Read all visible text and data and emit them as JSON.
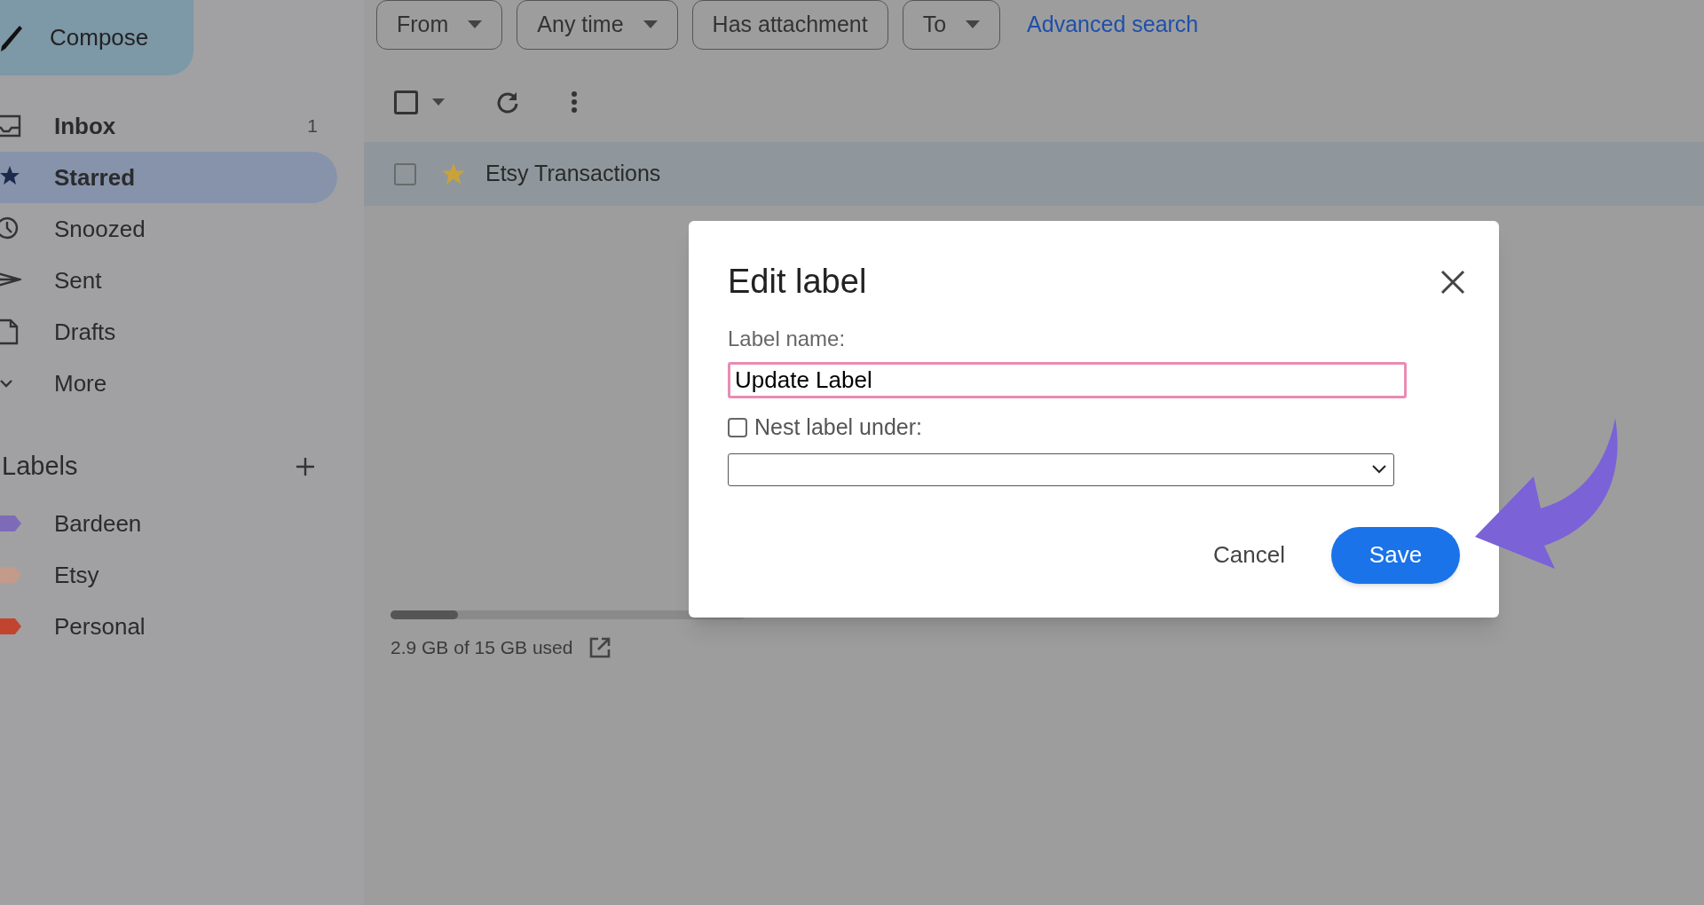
{
  "compose": {
    "label": "Compose"
  },
  "nav": [
    {
      "label": "Inbox",
      "count": "1",
      "unread": true,
      "selected": false
    },
    {
      "label": "Starred",
      "unread": false,
      "selected": true
    },
    {
      "label": "Snoozed",
      "unread": false,
      "selected": false
    },
    {
      "label": "Sent",
      "unread": false,
      "selected": false
    },
    {
      "label": "Drafts",
      "unread": false,
      "selected": false
    },
    {
      "label": "More",
      "unread": false,
      "selected": false
    }
  ],
  "labels_heading": "Labels",
  "labels": [
    {
      "label": "Bardeen",
      "color": "#7e6bb8"
    },
    {
      "label": "Etsy",
      "color": "#c49a8a"
    },
    {
      "label": "Personal",
      "color": "#c2442f"
    }
  ],
  "filters": [
    {
      "label": "From",
      "dropdown": true
    },
    {
      "label": "Any time",
      "dropdown": true
    },
    {
      "label": "Has attachment",
      "dropdown": false
    },
    {
      "label": "To",
      "dropdown": true
    }
  ],
  "advanced_search": "Advanced search",
  "toolbar": {
    "select_all_checked": false
  },
  "rows": [
    {
      "sender": "Etsy Transactions",
      "starred": true,
      "checked": false
    }
  ],
  "storage": {
    "level": 0.19,
    "text": "2.9 GB of 15 GB used"
  },
  "dialog": {
    "title": "Edit label",
    "field_label": "Label name:",
    "value": "Update Label",
    "nest": {
      "label": "Nest label under:",
      "checked": false
    },
    "cancel": "Cancel",
    "save": "Save"
  }
}
